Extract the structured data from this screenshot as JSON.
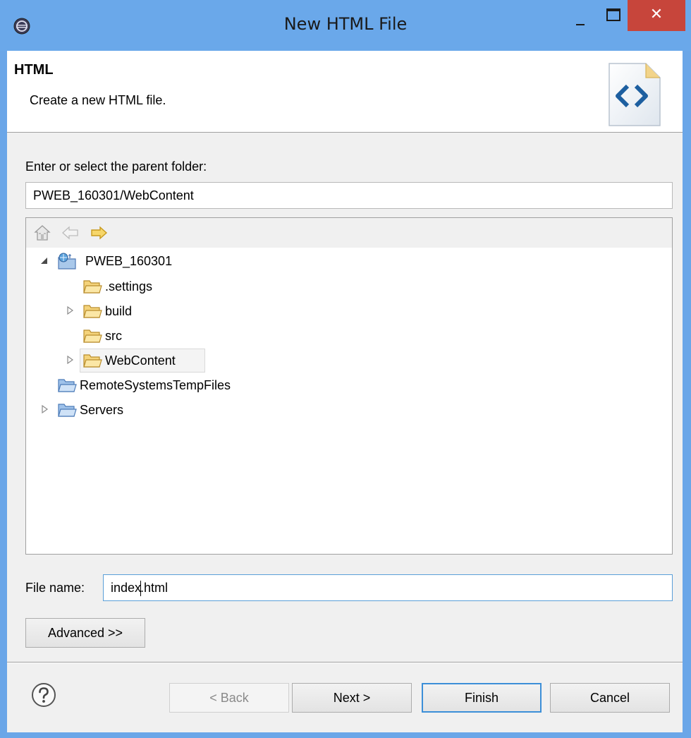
{
  "window": {
    "title": "New HTML File",
    "close_glyph": "✕"
  },
  "banner": {
    "title": "HTML",
    "description": "Create a new HTML file."
  },
  "folder": {
    "label": "Enter or select the parent folder:",
    "value": "PWEB_160301/WebContent"
  },
  "tree": {
    "items": [
      {
        "label": "PWEB_160301",
        "icon": "web-project-icon",
        "expanded": true
      },
      {
        "label": ".settings",
        "icon": "folder-icon"
      },
      {
        "label": "build",
        "icon": "folder-icon",
        "collapsed": true
      },
      {
        "label": "src",
        "icon": "folder-icon"
      },
      {
        "label": "WebContent",
        "icon": "folder-icon",
        "collapsed": true,
        "selected": true
      },
      {
        "label": "RemoteSystemsTempFiles",
        "icon": "folder-icon"
      },
      {
        "label": "Servers",
        "icon": "folder-icon",
        "collapsed": true
      }
    ]
  },
  "file": {
    "label": "File name:",
    "value_before_caret": "index",
    "value_after_caret": ".html"
  },
  "buttons": {
    "advanced": "Advanced >>",
    "back": "< Back",
    "next": "Next >",
    "finish": "Finish",
    "cancel": "Cancel"
  },
  "colors": {
    "titlebar": "#6aa8ea",
    "close": "#c7453b",
    "focus": "#3c8fd8",
    "folder": "#f0c35a"
  }
}
